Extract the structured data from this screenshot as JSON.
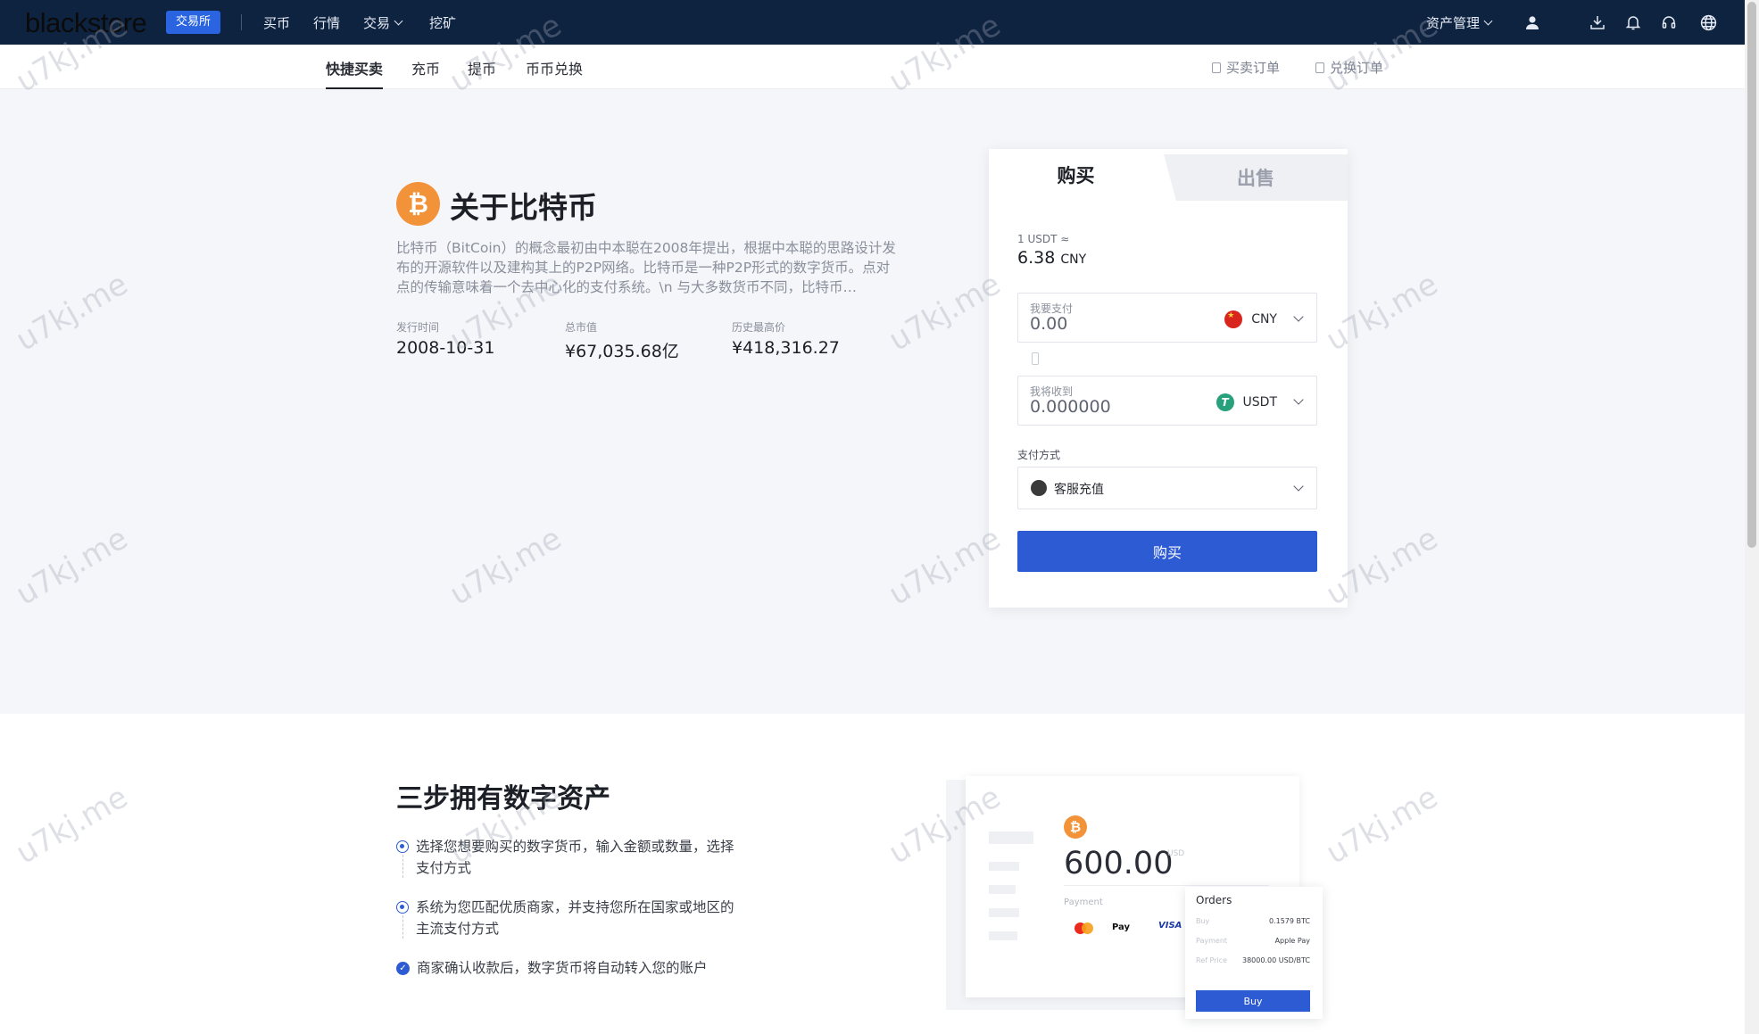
{
  "header": {
    "logo": "blackstore",
    "badge": "交易所",
    "nav": [
      {
        "label": "买币"
      },
      {
        "label": "行情"
      },
      {
        "label": "交易"
      },
      {
        "label": "挖矿"
      }
    ],
    "asset_menu": "资产管理"
  },
  "subnav": {
    "tabs": [
      {
        "label": "快捷买卖",
        "active": true
      },
      {
        "label": "充币"
      },
      {
        "label": "提币"
      },
      {
        "label": "币币兑换"
      }
    ],
    "links": [
      "买卖订单",
      "兑换订单"
    ]
  },
  "hero": {
    "coin_symbol": "₿",
    "title": "关于比特币",
    "description": "比特币（BitCoin）的概念最初由中本聪在2008年提出，根据中本聪的思路设计发布的开源软件以及建构其上的P2P网络。比特币是一种P2P形式的数字货币。点对点的传输意味着一个去中心化的支付系统。\\n 与大多数货币不同，比特币…",
    "stats": [
      {
        "label": "发行时间",
        "value": "2008-10-31"
      },
      {
        "label": "总市值",
        "value": "¥67,035.68亿"
      },
      {
        "label": "历史最高价",
        "value": "¥418,316.27"
      }
    ]
  },
  "trade": {
    "tab_buy": "购买",
    "tab_sell": "出售",
    "rate_label": "1 USDT ≈",
    "rate_value": "6.38",
    "rate_unit": "CNY",
    "pay": {
      "label": "我要支付",
      "value": "0.00",
      "currency": "CNY"
    },
    "receive": {
      "label": "我将收到",
      "value": "0.000000",
      "currency": "USDT",
      "currency_icon": "T"
    },
    "method_label": "支付方式",
    "method_value": "客服充值",
    "submit": "购买"
  },
  "steps": {
    "title": "三步拥有数字资产",
    "items": [
      "选择您想要购买的数字货币，输入金额或数量，选择支付方式",
      "系统为您匹配优质商家，并支持您所在国家或地区的主流支付方式",
      "商家确认收款后，数字货币将自动转入您的账户"
    ]
  },
  "mock": {
    "coin_symbol": "₿",
    "amount": "600.00",
    "unit": "USD",
    "payment_label": "Payment",
    "pay_logos": [
      "Pay",
      "VISA"
    ],
    "orders_title": "Orders",
    "rows": [
      {
        "k": "Buy",
        "v": "0.1579 BTC"
      },
      {
        "k": "Payment",
        "v": "Apple Pay"
      },
      {
        "k": "Ref Price",
        "v": "38000.00 USD/BTC"
      }
    ],
    "button": "Buy"
  },
  "watermark": "u7kj.me",
  "colors": {
    "nav_bg": "#0e2340",
    "accent": "#2d5bd3",
    "bitcoin": "#f2933a",
    "tether": "#26a17b"
  }
}
